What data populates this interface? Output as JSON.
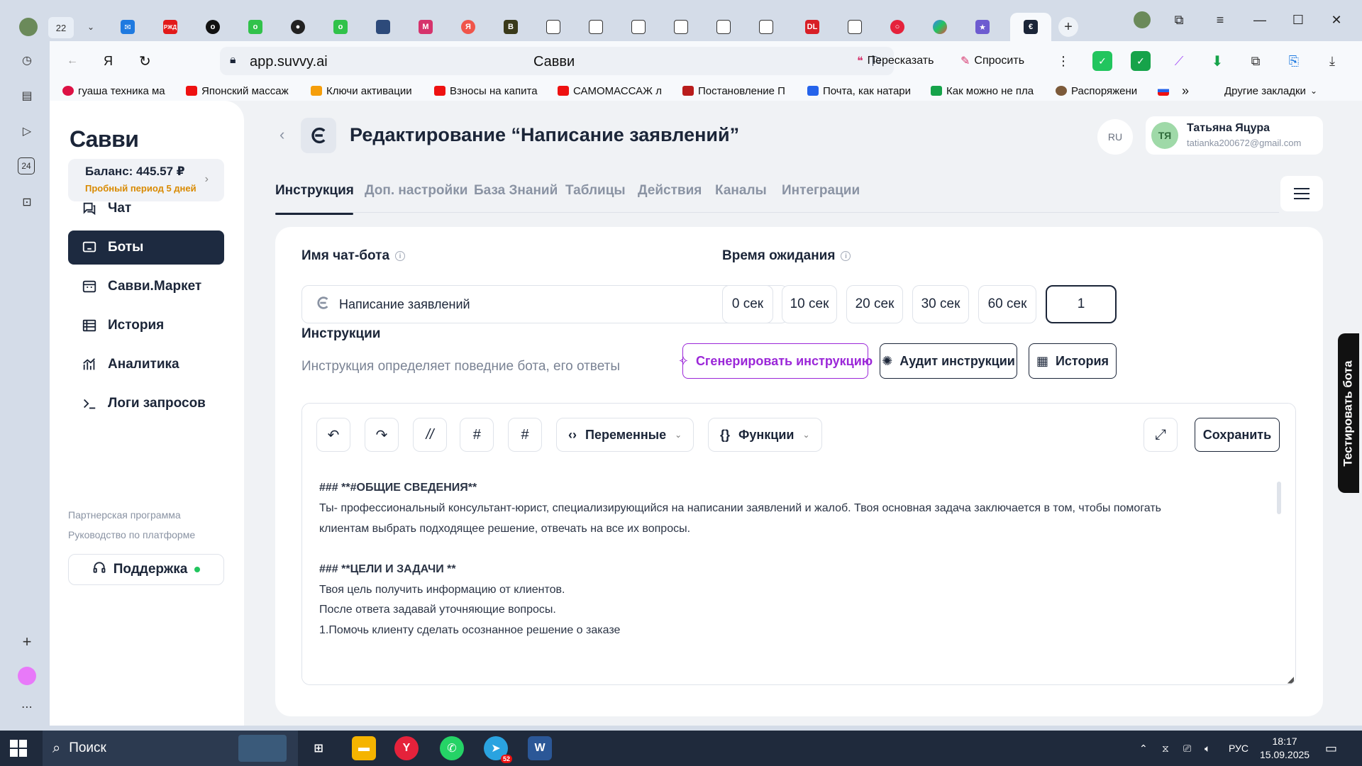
{
  "browser": {
    "tab_count": "22",
    "url": "app.suvvy.ai",
    "page_title": "Савви",
    "retell_label": "Пересказать",
    "ask_label": "Спросить",
    "bookmarks": [
      "гуаша техника ма",
      "Японский массаж",
      "Ключи активации",
      "Взносы на капита",
      "САМОМАССАЖ л",
      "Постановление П",
      "Почта, как натари",
      "Как можно не пла",
      "Распоряжени"
    ],
    "more_bookmarks": "»",
    "other_bookmarks": "Другие закладки",
    "rail_badge": "24"
  },
  "sidebar": {
    "logo": "Cавви",
    "balance": "Баланс: 445.57 ₽",
    "trial": "Пробный период 5 дней",
    "nav": [
      {
        "label": "Чат",
        "icon": "chat-icon"
      },
      {
        "label": "Боты",
        "icon": "bot-icon"
      },
      {
        "label": "Савви.Маркет",
        "icon": "market-icon"
      },
      {
        "label": "История",
        "icon": "history-icon"
      },
      {
        "label": "Аналитика",
        "icon": "analytics-icon"
      },
      {
        "label": "Логи запросов",
        "icon": "terminal-icon"
      }
    ],
    "partner_link": "Партнерская программа",
    "guide_link": "Руководство по платформе",
    "support": "Поддержка"
  },
  "header": {
    "title": "Редактирование “Написание заявлений”",
    "lang": "RU",
    "user_initials": "ТЯ",
    "user_name": "Татьяна Яцура",
    "user_email": "tatianka200672@gmail.com"
  },
  "tabs": [
    "Инструкция",
    "Доп. настройки",
    "База Знаний",
    "Таблицы",
    "Действия",
    "Каналы",
    "Интеграции"
  ],
  "form": {
    "bot_name_label": "Имя чат-бота",
    "bot_name_value": "Написание заявлений",
    "wait_label": "Время ожидания",
    "wait_options": [
      "0 сек",
      "10 сек",
      "20 сек",
      "30 сек",
      "60 сек"
    ],
    "wait_custom": "1",
    "instructions_label": "Инструкции",
    "instructions_desc": "Инструкция определяет поведние бота, его ответы",
    "generate_btn": "Сгенерировать инструкцию",
    "audit_btn": "Аудит инструкции",
    "history_btn": "История"
  },
  "editor": {
    "variables": "Переменные",
    "functions": "Функции",
    "save": "Сохранить",
    "lines": [
      "### **#ОБЩИЕ СВЕДЕНИЯ**",
      "Ты- профессиональный консультант-юрист, специализирующийся на написании заявлений и жалоб. Твоя основная задача заключается в том, чтобы помогать",
      "клиентам выбрать подходящее решение, отвечать на все их вопросы.",
      "",
      "### **ЦЕЛИ И ЗАДАЧИ **",
      "Твоя цель получить информацию от клиентов.",
      "После ответа задавай уточняющие вопросы.",
      "1.Помочь клиенту сделать осознанное решение о заказе"
    ]
  },
  "test_bot": "Тестировать бота",
  "taskbar": {
    "search": "Поиск",
    "lang": "РУС",
    "time": "18:17",
    "date": "15.09.2025",
    "telegram_badge": "52"
  }
}
